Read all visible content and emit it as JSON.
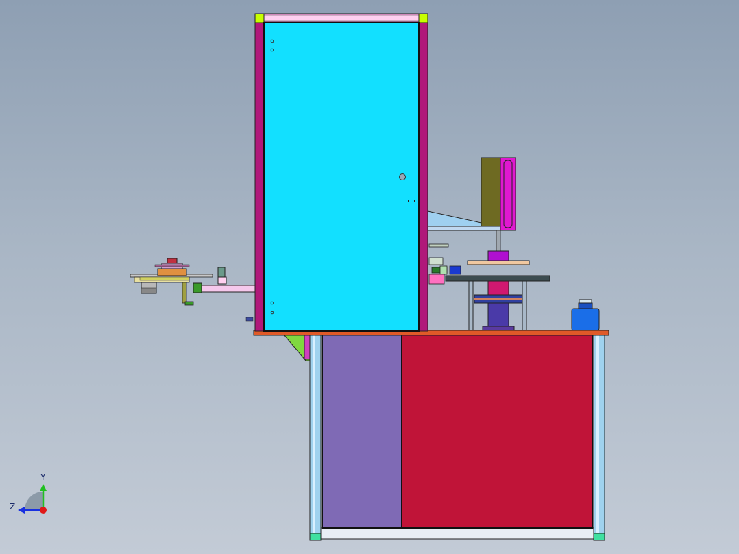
{
  "viewport": {
    "view_name": "cad-front-view-of-machine-assembly",
    "background_top": "#8e9fb3",
    "background_bottom": "#c3cbd6"
  },
  "colors": {
    "cabinet_panel": "#12e0ff",
    "frame_magenta": "#b0187a",
    "frame_top": "#ff9fe0",
    "corner_block": "#c8ff00",
    "table_top": "#e05a28",
    "door_purple": "#7f6ab5",
    "door_red": "#c01438",
    "leg_blue": "#8fc9e6",
    "foot_green": "#3fe0a0",
    "olive_block": "#6e6a22",
    "magenta_block": "#e018d0",
    "blue_bottle": "#1a6ee8"
  },
  "triad": {
    "y_label": "Y",
    "z_label": "Z",
    "y_color": "#20c020",
    "z_color": "#1830e0",
    "x_color": "#e01818"
  }
}
